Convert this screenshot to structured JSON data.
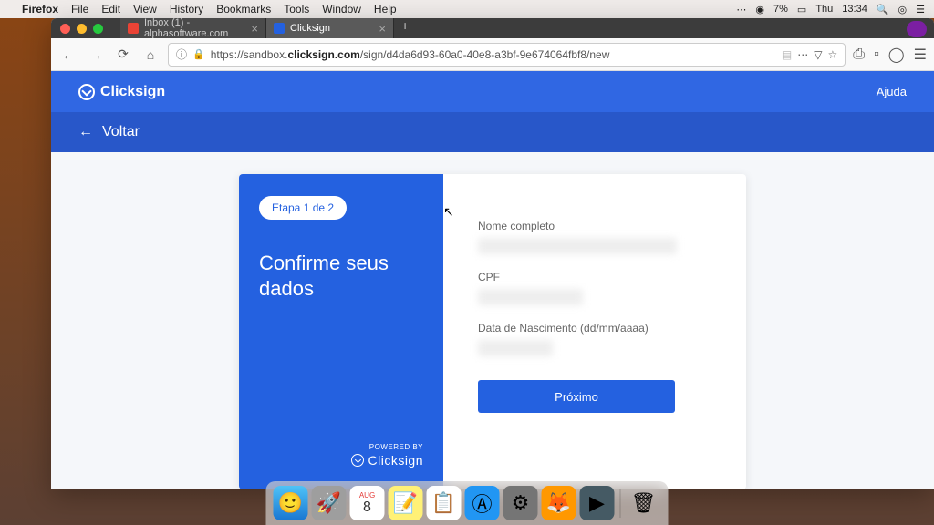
{
  "menubar": {
    "apple": "",
    "app": "Firefox",
    "items": [
      "File",
      "Edit",
      "View",
      "History",
      "Bookmarks",
      "Tools",
      "Window",
      "Help"
    ],
    "battery": "7%",
    "day": "Thu",
    "time": "13:34"
  },
  "browser": {
    "tabs": [
      {
        "label": "Inbox (1) - alphasoftware.com",
        "fav_color": "#ea4335"
      },
      {
        "label": "Clicksign",
        "fav_color": "#2461e0"
      }
    ],
    "url_prefix": "https://sandbox.",
    "url_domain": "clicksign.com",
    "url_path": "/sign/d4da6d93-60a0-40e8-a3bf-9e674064fbf8/new"
  },
  "page": {
    "brand": "Clicksign",
    "help": "Ajuda",
    "back": "Voltar",
    "step": "Etapa 1 de 2",
    "title": "Confirme seus dados",
    "powered_label": "POWERED BY",
    "powered_brand": "Clicksign",
    "fields": {
      "name_label": "Nome completo",
      "cpf_label": "CPF",
      "dob_label": "Data de Nascimento (dd/mm/aaaa)"
    },
    "next_btn": "Próximo"
  },
  "dock": {
    "calendar_month": "AUG",
    "calendar_day": "8"
  }
}
